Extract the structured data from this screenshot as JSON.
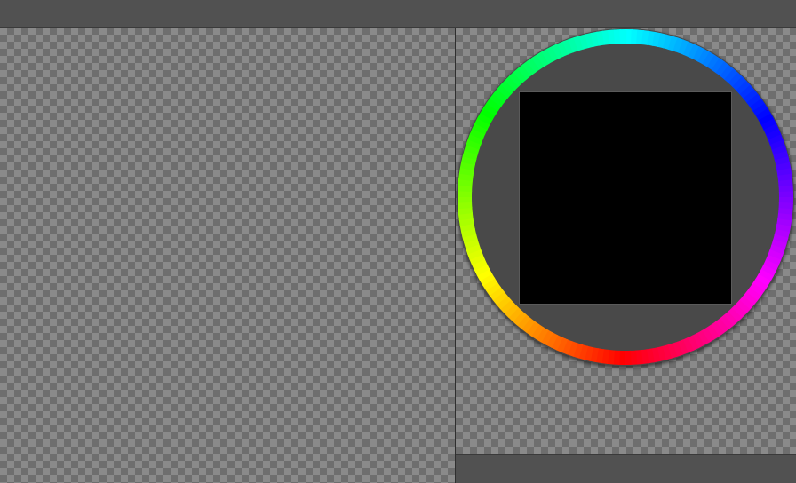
{
  "app": {
    "background_color": "#505050"
  },
  "canvas": {
    "pattern": "checkerboard",
    "colors": [
      "#8a8a8a",
      "#6e6e6e"
    ]
  },
  "color_picker": {
    "type": "hue-ring-with-sv-square",
    "ring_icon": "hue-ring-icon",
    "hue_stops": [
      "#00ffff",
      "#0000ff",
      "#ff00ff",
      "#ff0000",
      "#ffff00",
      "#00ff00"
    ],
    "inner_background": "#484848",
    "selected_color": "#000000"
  }
}
